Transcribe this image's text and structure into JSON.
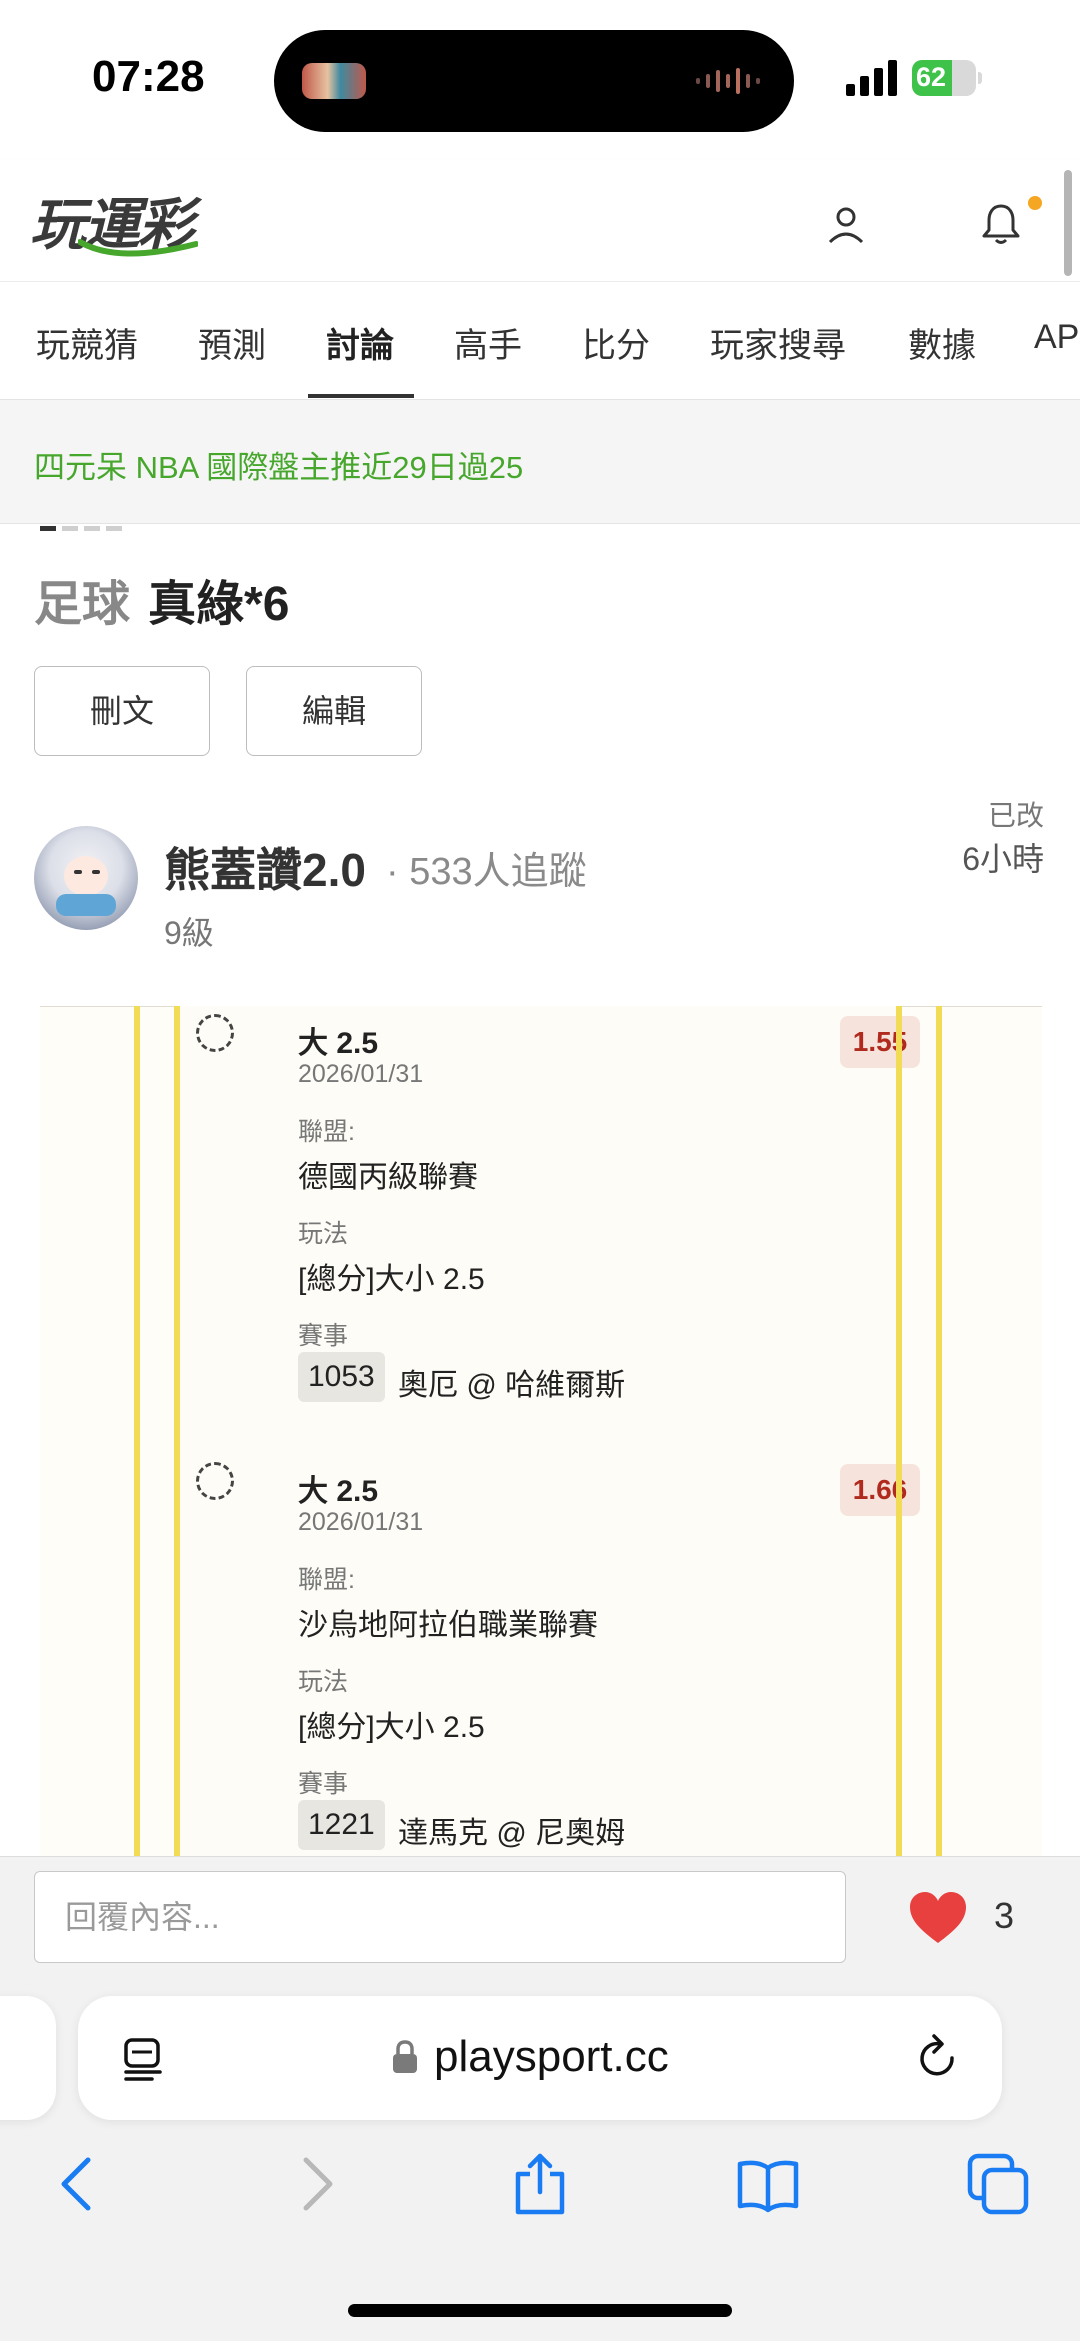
{
  "status": {
    "time": "07:28",
    "battery": "62"
  },
  "header": {
    "logo": "玩運彩"
  },
  "tabs": [
    {
      "label": "玩競猜"
    },
    {
      "label": "預測"
    },
    {
      "label": "討論"
    },
    {
      "label": "高手"
    },
    {
      "label": "比分"
    },
    {
      "label": "玩家搜尋"
    },
    {
      "label": "數據"
    },
    {
      "label": "AP"
    }
  ],
  "active_tab": "討論",
  "ticker": {
    "text": "四元呆 NBA 國際盤主推近29日過25"
  },
  "post": {
    "category": "足球",
    "title": "真綠*6",
    "delete_label": "刪文",
    "edit_label": "編輯"
  },
  "author": {
    "name": "熊蓋讚2.0",
    "followers": "· 533人追蹤",
    "level": "9級",
    "edited": "已改",
    "time_ago": "6小時"
  },
  "slip": {
    "picks": [
      {
        "name": "大 2.5",
        "odds": "1.55",
        "date": "2026/01/31",
        "league_label": "聯盟:",
        "league": "德國丙級聯賽",
        "market_label": "玩法",
        "market": "[總分]大小 2.5",
        "game_label": "賽事",
        "game_no": "1053",
        "game": "奧厄 @ 哈維爾斯"
      },
      {
        "name": "大 2.5",
        "odds": "1.66",
        "date": "2026/01/31",
        "league_label": "聯盟:",
        "league": "沙烏地阿拉伯職業聯賽",
        "market_label": "玩法",
        "market": "[總分]大小 2.5",
        "game_label": "賽事",
        "game_no": "1221",
        "game": "達馬克 @ 尼奧姆"
      }
    ]
  },
  "reply": {
    "placeholder": "回覆內容...",
    "likes": "3"
  },
  "browser": {
    "url": "playsport.cc"
  },
  "icons": {
    "user": "user-icon",
    "bell": "bell-icon",
    "heart": "heart-icon",
    "reader": "reader-icon",
    "lock": "lock-icon",
    "reload": "reload-icon",
    "back": "back-icon",
    "forward": "forward-icon",
    "share": "share-icon",
    "bookmarks": "bookmarks-icon",
    "tabs": "tabs-icon"
  },
  "colors": {
    "accent_green": "#47a72d",
    "odds_red": "#b02a1d",
    "ios_blue": "#1a7cf2",
    "heart": "#e8403f"
  }
}
